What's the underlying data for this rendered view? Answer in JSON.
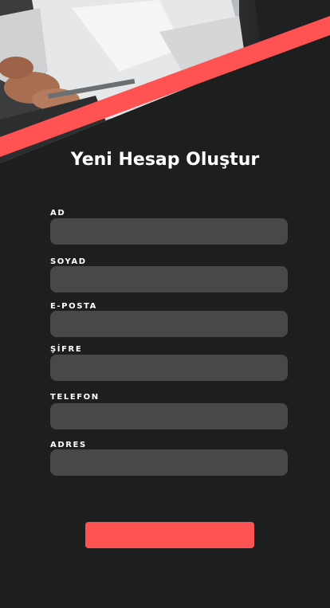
{
  "page": {
    "title": "Yeni Hesap Oluştur"
  },
  "form": {
    "fields": [
      {
        "label": "AD",
        "value": "",
        "placeholder": ""
      },
      {
        "label": "SOYAD",
        "value": "",
        "placeholder": ""
      },
      {
        "label": "E-POSTA",
        "value": "",
        "placeholder": ""
      },
      {
        "label": "ŞİFRE",
        "value": "",
        "placeholder": ""
      },
      {
        "label": "TELEFON",
        "value": "",
        "placeholder": ""
      },
      {
        "label": "ADRES",
        "value": "",
        "placeholder": ""
      }
    ],
    "submit_label": ""
  },
  "colors": {
    "background": "#1d1f1f",
    "accent": "#ff5252",
    "input_background": "#474949",
    "text": "#ffffff"
  }
}
